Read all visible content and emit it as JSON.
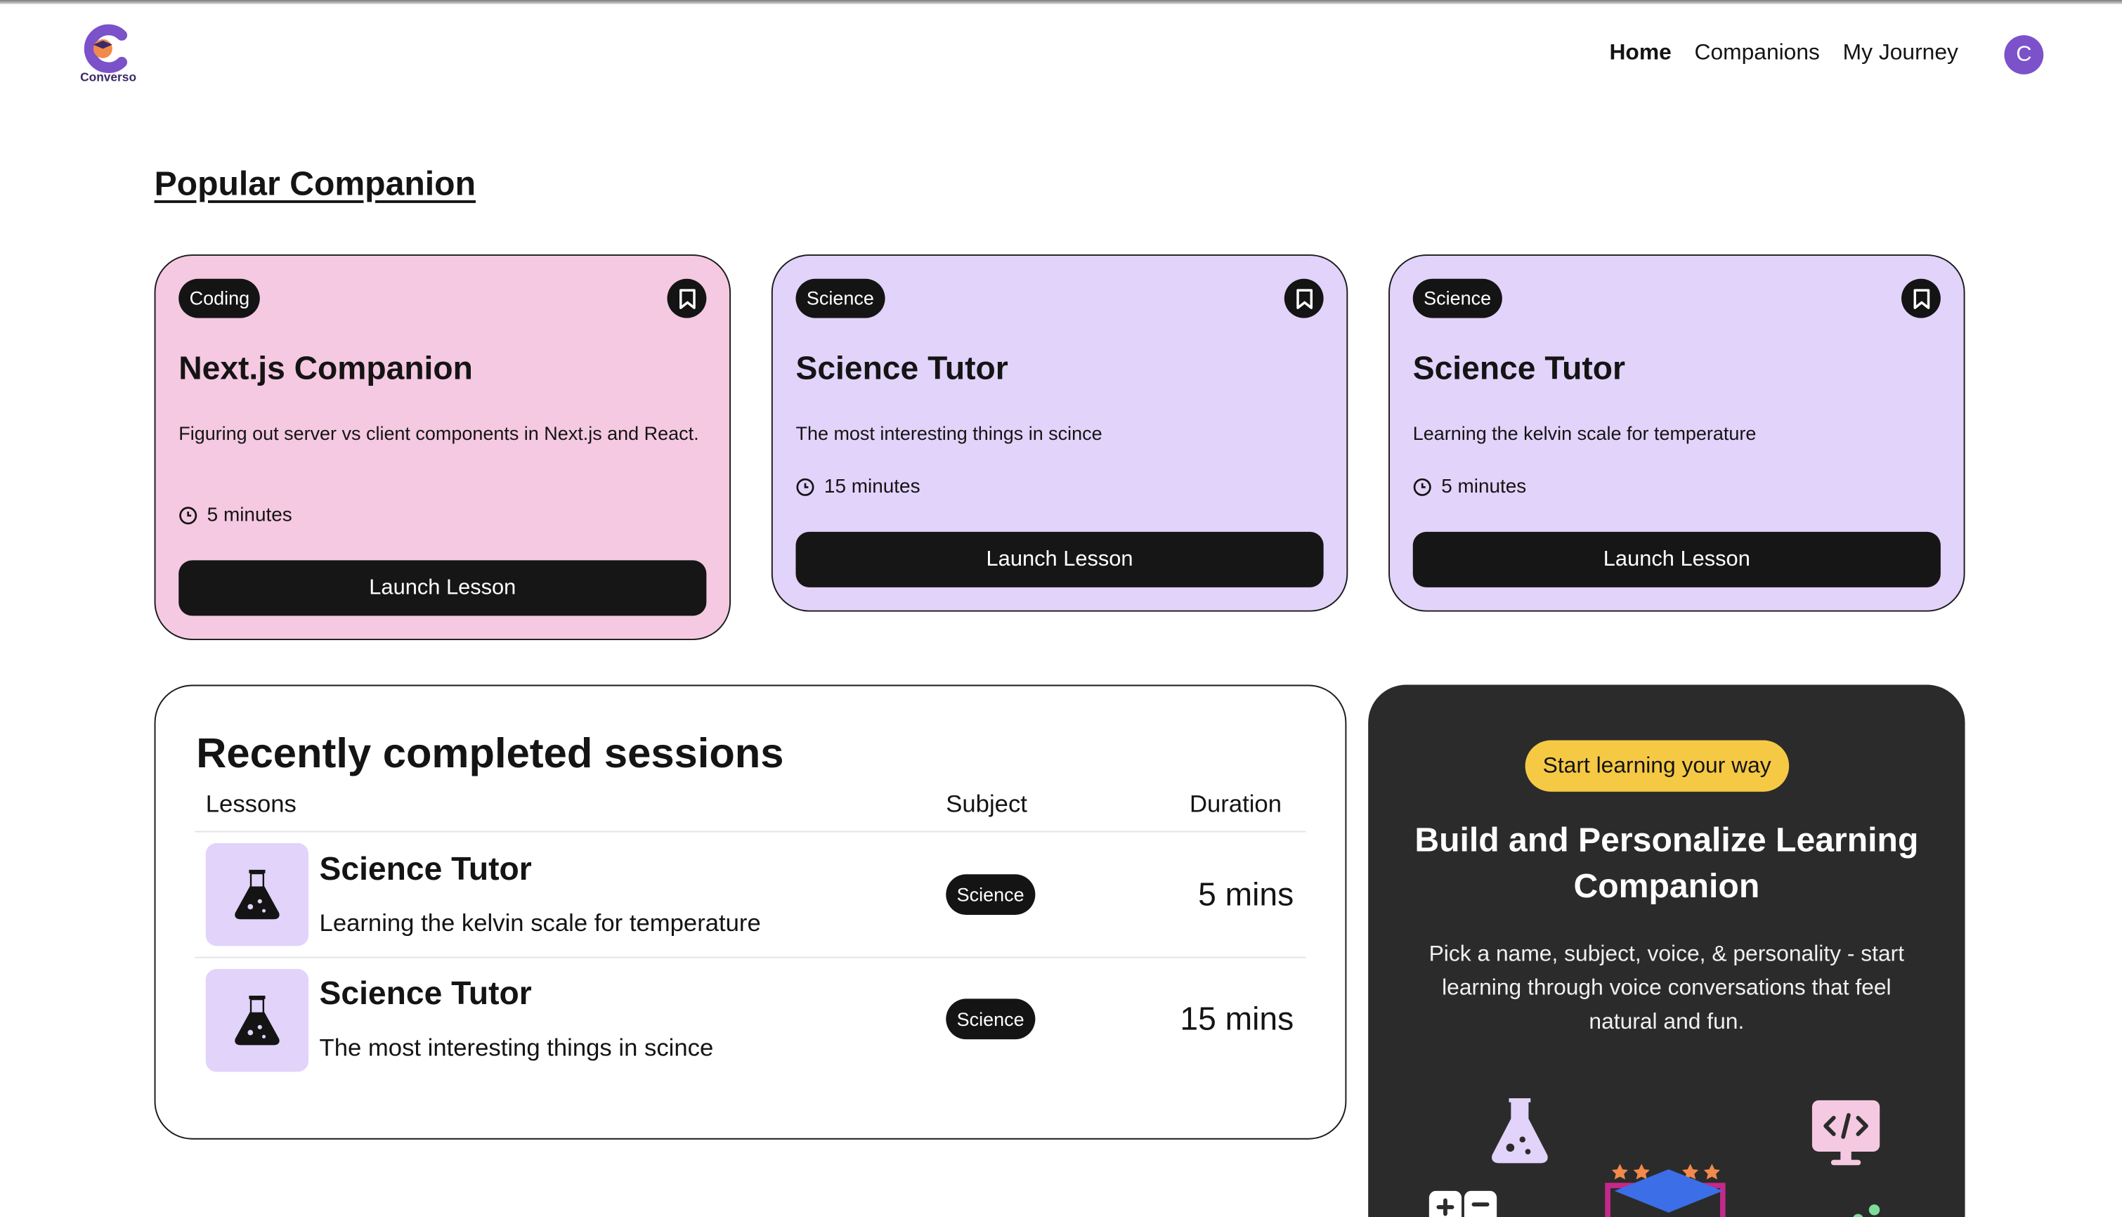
{
  "nav": {
    "logo_text": "Converso",
    "links": [
      "Home",
      "Companions",
      "My Journey"
    ],
    "avatar_initial": "C"
  },
  "popular": {
    "title": "Popular Companion",
    "cards": [
      {
        "subject": "Coding",
        "name": "Next.js Companion",
        "topic": "Figuring out server vs client components in Next.js and React.",
        "duration": "5 minutes",
        "cta": "Launch Lesson",
        "color": "#f5c9e1"
      },
      {
        "subject": "Science",
        "name": "Science Tutor",
        "topic": "The most interesting things in scince",
        "duration": "15 minutes",
        "cta": "Launch Lesson",
        "color": "#e2d3fb"
      },
      {
        "subject": "Science",
        "name": "Science Tutor",
        "topic": "Learning the kelvin scale for temperature",
        "duration": "5 minutes",
        "cta": "Launch Lesson",
        "color": "#e2d3fb"
      }
    ]
  },
  "recent": {
    "title": "Recently completed sessions",
    "headers": {
      "lessons": "Lessons",
      "subject": "Subject",
      "duration": "Duration"
    },
    "rows": [
      {
        "name": "Science Tutor",
        "topic": "Learning the kelvin scale for temperature",
        "subject": "Science",
        "duration": "5 mins",
        "icon": "flask-icon"
      },
      {
        "name": "Science Tutor",
        "topic": "The most interesting things in scince",
        "subject": "Science",
        "duration": "15 mins",
        "icon": "flask-icon"
      }
    ]
  },
  "cta": {
    "pill": "Start learning your way",
    "title": "Build and Personalize Learning Companion",
    "description": "Pick a name, subject, voice, & personality - start learning through voice conversations that feel natural and fun.",
    "accent": "#f6c945"
  }
}
